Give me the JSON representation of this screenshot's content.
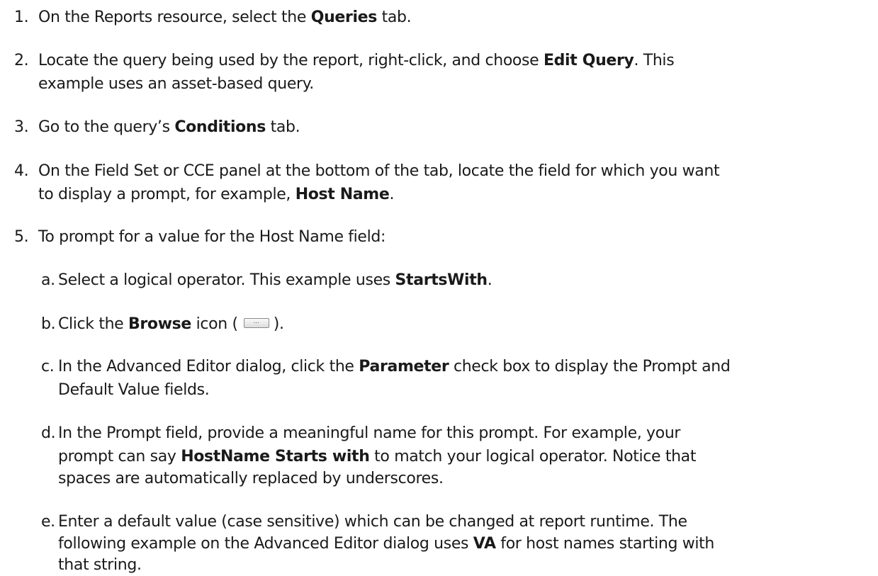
{
  "steps": [
    {
      "num": "1.",
      "t1": "On the Reports resource, select the ",
      "b1": "Queries",
      "t2": " tab."
    },
    {
      "num": "2.",
      "t1": "Locate the query being used by the report, right-click, and choose ",
      "b1": "Edit Query",
      "t2": ". This",
      "line2": "example uses an asset-based query."
    },
    {
      "num": "3.",
      "t1": "Go to the query’s ",
      "b1": "Conditions",
      "t2": " tab."
    },
    {
      "num": "4.",
      "t1": "On the Field Set or CCE panel at the bottom of the tab, locate the field for which you want",
      "line2_a": "to display a prompt, for example, ",
      "line2_b": "Host Name",
      "line2_c": "."
    },
    {
      "num": "5.",
      "t1": "To prompt for a value for the Host Name field:"
    }
  ],
  "substeps": {
    "a": {
      "letter": "a.",
      "t1": "Select a logical operator. This example uses ",
      "b1": "StartsWith",
      "t2": "."
    },
    "b": {
      "letter": "b.",
      "t1": "Click the ",
      "b1": "Browse",
      "t2": " icon (",
      "icon_glyph": "...",
      "t3": ")."
    },
    "c": {
      "letter": "c.",
      "t1": "In the Advanced Editor dialog, click the ",
      "b1": "Parameter",
      "t2": " check box to display the Prompt and",
      "line2": "Default Value fields."
    },
    "d": {
      "letter": "d.",
      "l1": "In the Prompt field, provide a meaningful name for this prompt. For example, your",
      "l2a": "prompt can say ",
      "l2b": "HostName Starts with",
      "l2c": " to match your logical operator. Notice that",
      "l3": "spaces are automatically replaced by underscores."
    },
    "e": {
      "letter": "e.",
      "l1": "Enter a default value (case sensitive) which can be changed at report runtime. The",
      "l2a": "following example on the Advanced Editor dialog uses ",
      "l2b": "VA",
      "l2c": " for host names starting with",
      "l3": "that string."
    }
  }
}
